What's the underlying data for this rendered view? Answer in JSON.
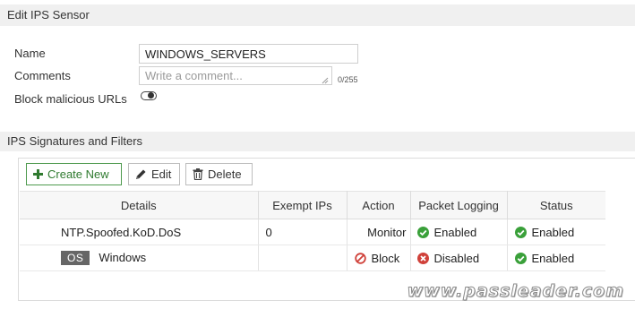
{
  "header": {
    "title": "Edit IPS Sensor"
  },
  "form": {
    "name_label": "Name",
    "name_value": "WINDOWS_SERVERS",
    "comments_label": "Comments",
    "comments_placeholder": "Write a comment...",
    "comments_count": "0/255",
    "block_urls_label": "Block malicious URLs",
    "block_urls_enabled": false
  },
  "signatures_section": {
    "title": "IPS Signatures and Filters"
  },
  "toolbar": {
    "create_label": "Create New",
    "edit_label": "Edit",
    "delete_label": "Delete"
  },
  "table": {
    "columns": [
      "Details",
      "Exempt IPs",
      "Action",
      "Packet Logging",
      "Status"
    ],
    "rows": [
      {
        "details": "NTP.Spoofed.KoD.DoS",
        "exempt": "0",
        "action": "Monitor",
        "logging": "Enabled",
        "status": "Enabled"
      },
      {
        "tag": "OS",
        "details": "Windows",
        "exempt": "",
        "action": "Block",
        "logging": "Disabled",
        "status": "Enabled"
      }
    ]
  },
  "colors": {
    "enabled_green": "#3aa03a",
    "disabled_red": "#d0413a",
    "block_red": "#d0413a",
    "create_green": "#2f7a2f"
  },
  "icons": [
    "plus-icon",
    "pencil-icon",
    "trash-icon",
    "check-circle-icon",
    "x-circle-icon",
    "block-icon"
  ],
  "watermark": "www.passleader.com"
}
